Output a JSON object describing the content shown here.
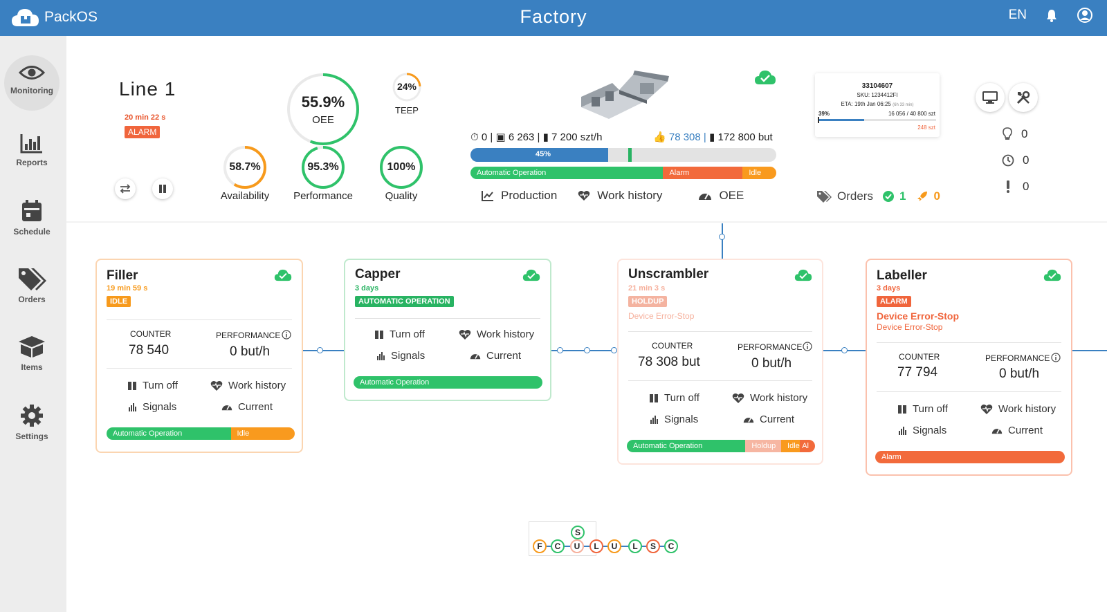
{
  "header": {
    "app_name": "PackOS",
    "title": "Factory",
    "language": "EN"
  },
  "sidebar": {
    "items": [
      {
        "label": "Monitoring",
        "icon": "eye-icon"
      },
      {
        "label": "Reports",
        "icon": "bar-chart-icon"
      },
      {
        "label": "Schedule",
        "icon": "calendar-icon"
      },
      {
        "label": "Orders",
        "icon": "tag-icon"
      },
      {
        "label": "Items",
        "icon": "box-icon"
      },
      {
        "label": "Settings",
        "icon": "gear-icon"
      }
    ]
  },
  "line": {
    "name": "Line 1",
    "time": "20 min 22 s",
    "status": "ALARM",
    "oee": {
      "value": "55.9%",
      "label": "OEE",
      "fraction": 0.559
    },
    "teep": {
      "value": "24%",
      "label": "TEEP",
      "fraction": 0.24
    },
    "availability": {
      "value": "58.7%",
      "label": "Availability",
      "fraction": 0.587
    },
    "performance": {
      "value": "95.3%",
      "label": "Performance",
      "fraction": 0.953
    },
    "quality": {
      "value": "100%",
      "label": "Quality",
      "fraction": 1.0
    },
    "stats": {
      "stops": "0",
      "planned": "6 263",
      "rate": "7 200 szt/h",
      "good": "78 308",
      "total": "172 800 but"
    },
    "progress": {
      "label": "45%",
      "fraction": 0.45
    },
    "state_bar": [
      {
        "label": "Automatic Operation",
        "fraction": 0.63,
        "color": "#2fc26a"
      },
      {
        "label": "Alarm",
        "fraction": 0.26,
        "color": "#f26a3b"
      },
      {
        "label": "Idle",
        "fraction": 0.11,
        "color": "#f99a1e"
      }
    ],
    "tabs": [
      "Production",
      "Work history",
      "OEE"
    ]
  },
  "order": {
    "id": "33104607",
    "sku": "SKU: 1234412FI",
    "eta": "ETA: 19th Jan 06:25",
    "eta_note": "(6h 33 min)",
    "percent": "39%",
    "progress_fraction": 0.39,
    "count": "16 056 / 40 800 szt",
    "extra": "248 szt"
  },
  "orders_summary": {
    "label": "Orders",
    "done": "1",
    "active": "0"
  },
  "alerts": {
    "ideas": "0",
    "delays": "0",
    "warnings": "0"
  },
  "machines": [
    {
      "name": "Filler",
      "time": "19 min 59 s",
      "status": "IDLE",
      "counter_label": "COUNTER",
      "counter": "78 540",
      "performance_label": "PERFORMANCE",
      "performance": "0 but/h",
      "actions": [
        "Turn off",
        "Work history",
        "Signals",
        "Current"
      ],
      "state_bar": [
        {
          "label": "Automatic Operation",
          "fraction": 0.66
        },
        {
          "label": "Idle",
          "fraction": 0.34
        }
      ]
    },
    {
      "name": "Capper",
      "time": "3 days",
      "status": "AUTOMATIC OPERATION",
      "actions": [
        "Turn off",
        "Work history",
        "Signals",
        "Current"
      ],
      "state_bar": [
        {
          "label": "Automatic Operation",
          "fraction": 1.0
        }
      ]
    },
    {
      "name": "Unscrambler",
      "time": "21 min 3 s",
      "status": "HOLDUP",
      "error": "Device Error-Stop",
      "counter_label": "COUNTER",
      "counter": "78 308 but",
      "performance_label": "PERFORMANCE",
      "performance": "0 but/h",
      "actions": [
        "Turn off",
        "Work history",
        "Signals",
        "Current"
      ],
      "state_bar": [
        {
          "label": "Automatic Operation",
          "fraction": 0.63
        },
        {
          "label": "Holdup",
          "fraction": 0.19
        },
        {
          "label": "Idle",
          "fraction": 0.1
        },
        {
          "label": "Al",
          "fraction": 0.08
        }
      ]
    },
    {
      "name": "Labeller",
      "time": "3 days",
      "status": "ALARM",
      "error_main": "Device Error-Stop",
      "error_sub": "Device Error-Stop",
      "counter_label": "COUNTER",
      "counter": "77 794",
      "performance_label": "PERFORMANCE",
      "performance": "0 but/h",
      "actions": [
        "Turn off",
        "Work history",
        "Signals",
        "Current"
      ],
      "state_bar": [
        {
          "label": "Alarm",
          "fraction": 1.0
        }
      ]
    }
  ],
  "minimap": {
    "top": "S",
    "nodes": [
      "F",
      "C",
      "U",
      "L",
      "U",
      "L",
      "S",
      "C"
    ]
  }
}
